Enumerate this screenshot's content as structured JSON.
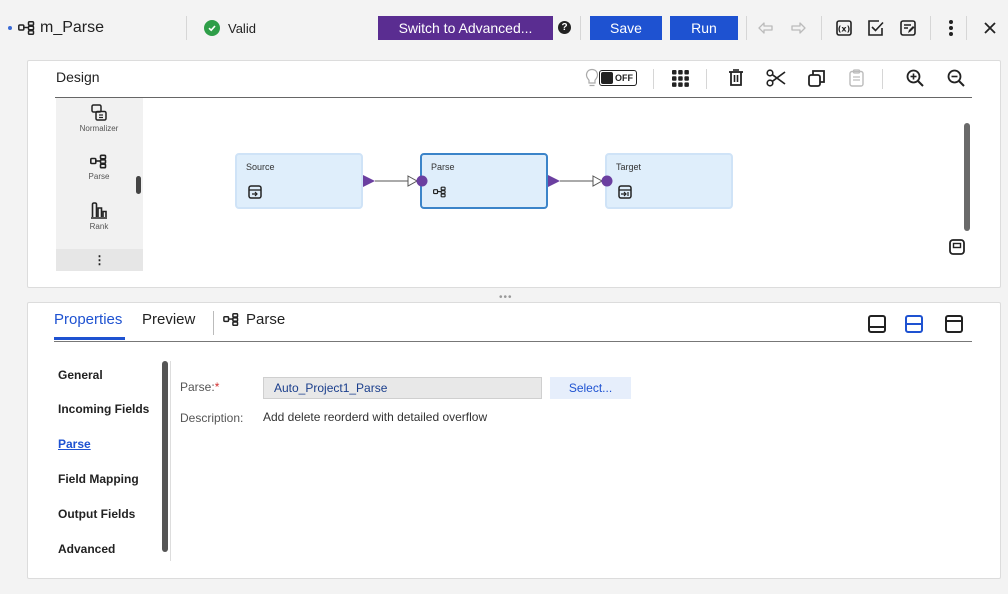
{
  "header": {
    "mapping_name": "m_Parse",
    "status": "Valid",
    "switch_advanced_label": "Switch to Advanced...",
    "save_label": "Save",
    "run_label": "Run"
  },
  "design": {
    "title": "Design",
    "toggle_label": "OFF",
    "palette": [
      {
        "label": "Normalizer",
        "icon": "normalizer-icon"
      },
      {
        "label": "Parse",
        "icon": "parse-icon"
      },
      {
        "label": "Rank",
        "icon": "rank-icon"
      }
    ],
    "palette_more": "⋮",
    "nodes": [
      {
        "label": "Source",
        "icon": "source-icon"
      },
      {
        "label": "Parse",
        "icon": "parse-icon"
      },
      {
        "label": "Target",
        "icon": "target-icon"
      }
    ],
    "grip": "•••"
  },
  "properties": {
    "tabs": [
      {
        "label": "Properties"
      },
      {
        "label": "Preview"
      }
    ],
    "object_tab_label": "Parse",
    "nav": [
      "General",
      "Incoming Fields",
      "Parse",
      "Field Mapping",
      "Output Fields",
      "Advanced"
    ],
    "nav_active": "Parse",
    "parse_label": "Parse:",
    "parse_required": "*",
    "parse_value": "Auto_Project1_Parse",
    "select_label": "Select...",
    "description_label": "Description:",
    "description_value": "Add delete reorderd with detailed overflow"
  },
  "colors": {
    "primary": "#1e52d1",
    "advanced": "#5a2d91",
    "valid": "#2e9e48",
    "port": "#6b3fa0",
    "node_fill": "#dfeefb",
    "node_selected_border": "#3b84c9"
  }
}
